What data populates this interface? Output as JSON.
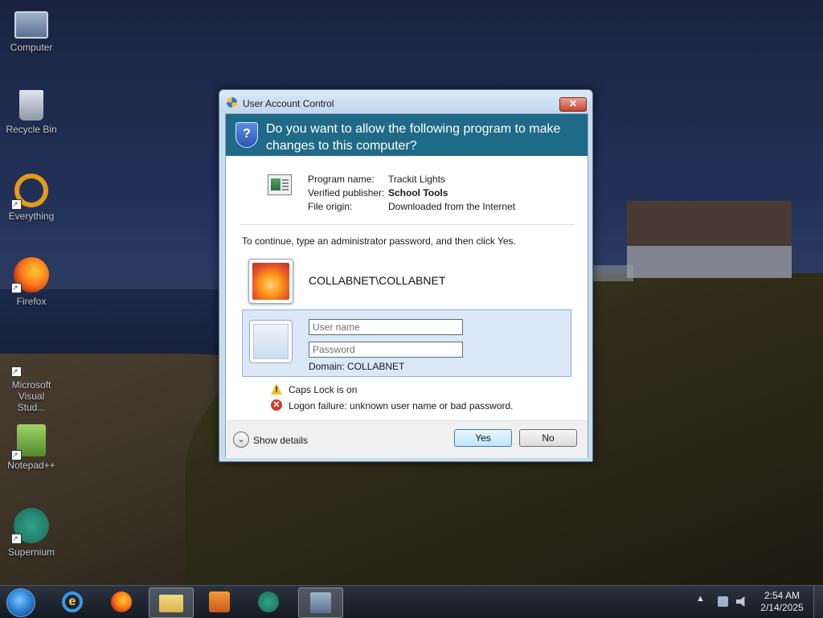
{
  "desktop": {
    "icons": [
      {
        "label": "Computer",
        "icon": "computer-icon"
      },
      {
        "label": "Recycle Bin",
        "icon": "recycle-bin-icon"
      },
      {
        "label": "Everything",
        "icon": "everything-icon"
      },
      {
        "label": "Firefox",
        "icon": "firefox-icon"
      },
      {
        "label": "Microsoft Visual Stud...",
        "icon": "visual-studio-icon"
      },
      {
        "label": "Notepad++",
        "icon": "notepadpp-icon"
      },
      {
        "label": "Supernium",
        "icon": "supernium-icon"
      }
    ]
  },
  "dialog": {
    "title": "User Account Control",
    "close_glyph": "✕",
    "question": "Do you want to allow the following program to make changes to this computer?",
    "program_name_label": "Program name:",
    "program_name": "Trackit Lights",
    "publisher_label": "Verified publisher:",
    "publisher": "School Tools",
    "origin_label": "File origin:",
    "origin": "Downloaded from the Internet",
    "instruction": "To continue, type an administrator password, and then click Yes.",
    "admin_account": "COLLABNET\\COLLABNET",
    "username_placeholder": "User name",
    "username_value": "",
    "password_placeholder": "Password",
    "password_value": "",
    "domain_text": "Domain: COLLABNET",
    "caps_lock_warning": "Caps Lock is on",
    "logon_error": "Logon failure: unknown user name or bad password.",
    "show_details": "Show details",
    "yes_label": "Yes",
    "no_label": "No"
  },
  "taskbar": {
    "apps": [
      "Internet Explorer",
      "Firefox",
      "File Explorer",
      "Media Player",
      "Supernium",
      "User Account Control"
    ],
    "active_app": "File Explorer",
    "tray_arrow": "▲",
    "time": "2:54 AM",
    "date": "2/14/2025"
  },
  "colors": {
    "banner": "#1f6a86",
    "credential_panel": "#dbe8f7",
    "caps_warning": "#f2c230",
    "error": "#d23a2a"
  }
}
